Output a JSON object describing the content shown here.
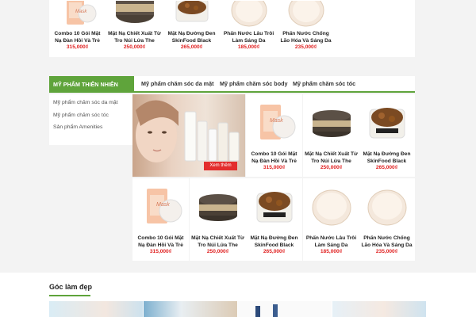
{
  "top_products": [
    {
      "name": "Combo 10 Gói Mặt Nạ Đàn Hồi Và Trẻ",
      "price": "315,000₫",
      "icon": "mask-pack-icon"
    },
    {
      "name": "Mặt Nạ Chiết Xuất Từ Tro Núi Lửa The",
      "price": "250,000₫",
      "icon": "jar-icon"
    },
    {
      "name": "Mặt Nạ Đường Đen SkinFood Black",
      "price": "265,000₫",
      "icon": "jar-icon"
    },
    {
      "name": "Phấn Nước Lâu Trôi Làm Sáng Da",
      "price": "185,000₫",
      "icon": "cushion-icon"
    },
    {
      "name": "Phấn Nước Chống Lão Hóa Và Sáng Da",
      "price": "235,000₫",
      "icon": "cushion-icon"
    }
  ],
  "category": {
    "title": "MỸ PHẨM THIÊN NHIÊN",
    "tabs": [
      "Mỹ phẩm chăm sóc da mặt",
      "Mỹ phẩm chăm sóc body",
      "Mỹ phẩm chăm sóc tóc"
    ],
    "sidebar": [
      "Mỹ phẩm chăm sóc da mặt",
      "Mỹ phẩm chăm sóc tóc",
      "Sản phẩm Amenities"
    ],
    "banner_button": "Xem thêm",
    "products_row1": [
      {
        "name": "Combo 10 Gói Mặt Nạ Đàn Hồi Và Trẻ",
        "price": "315,000₫",
        "icon": "mask-pack-icon"
      },
      {
        "name": "Mặt Nạ Chiết Xuất Từ Tro Núi Lửa The",
        "price": "250,000₫",
        "icon": "jar-icon"
      },
      {
        "name": "Mặt Nạ Đường Đen SkinFood Black",
        "price": "265,000₫",
        "icon": "jar-icon"
      }
    ],
    "products_row2": [
      {
        "name": "Combo 10 Gói Mặt Nạ Đàn Hồi Và Trẻ",
        "price": "315,000₫",
        "icon": "mask-pack-icon"
      },
      {
        "name": "Mặt Nạ Chiết Xuất Từ Tro Núi Lửa The",
        "price": "250,000₫",
        "icon": "jar-icon"
      },
      {
        "name": "Mặt Nạ Đường Đen SkinFood Black",
        "price": "265,000₫",
        "icon": "jar-icon"
      },
      {
        "name": "Phấn Nước Lâu Trôi Làm Sáng Da",
        "price": "185,000₫",
        "icon": "cushion-icon"
      },
      {
        "name": "Phấn Nước Chống Lão Hóa Và Sáng Da",
        "price": "235,000₫",
        "icon": "cushion-icon"
      }
    ]
  },
  "beauty_corner": {
    "title": "Góc làm đẹp"
  },
  "colors": {
    "accent": "#5fa43b",
    "price": "#e02020",
    "button": "#e32d2d"
  }
}
